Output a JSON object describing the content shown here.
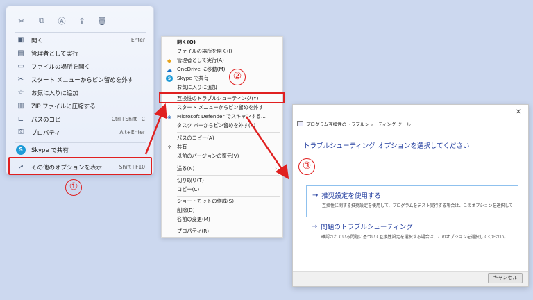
{
  "menu1": {
    "toolbar": [
      {
        "icon": "cut-icon",
        "glyph": "✂"
      },
      {
        "icon": "copy-icon",
        "glyph": "⧉"
      },
      {
        "icon": "rename-icon",
        "glyph": "Ⓐ"
      },
      {
        "icon": "share-icon",
        "glyph": "⇪"
      },
      {
        "icon": "delete-icon",
        "glyph": "🗑"
      }
    ],
    "items": [
      {
        "label": "開く",
        "shortcut": "Enter",
        "icon": "open-icon",
        "glyph": "▣"
      },
      {
        "label": "管理者として実行",
        "shortcut": "",
        "icon": "admin-run-icon",
        "glyph": "▤"
      },
      {
        "label": "ファイルの場所を開く",
        "shortcut": "",
        "icon": "folder-icon",
        "glyph": "▭"
      },
      {
        "label": "スタート メニューからピン留めを外す",
        "shortcut": "",
        "icon": "unpin-icon",
        "glyph": "✂"
      },
      {
        "label": "お気に入りに追加",
        "shortcut": "",
        "icon": "star-icon",
        "glyph": "☆"
      },
      {
        "label": "ZIP ファイルに圧縮する",
        "shortcut": "",
        "icon": "zip-icon",
        "glyph": "▥"
      },
      {
        "label": "パスのコピー",
        "shortcut": "Ctrl+Shift+C",
        "icon": "copy-path-icon",
        "glyph": "⊏"
      },
      {
        "label": "プロパティ",
        "shortcut": "Alt+Enter",
        "icon": "properties-icon",
        "glyph": "⚿"
      },
      {
        "label": "Skype で共有",
        "shortcut": "",
        "icon": "skype-icon",
        "glyph": "S"
      },
      {
        "label": "その他のオプションを表示",
        "shortcut": "Shift+F10",
        "icon": "more-options-icon",
        "glyph": "↗"
      }
    ]
  },
  "menu2": {
    "items": [
      {
        "label": "開く(O)",
        "icon": "",
        "glyph": "",
        "bold": true
      },
      {
        "label": "ファイルの場所を開く(I)",
        "icon": "",
        "glyph": ""
      },
      {
        "label": "管理者として実行(A)",
        "icon": "shield-icon",
        "glyph": "◆"
      },
      {
        "label": "OneDrive に移動(M)",
        "icon": "onedrive-icon",
        "glyph": "☁"
      },
      {
        "label": "Skype で共有",
        "icon": "skype-icon",
        "glyph": "S"
      },
      {
        "label": "お気に入りに追加",
        "icon": "",
        "glyph": ""
      },
      {
        "label": "互換性のトラブルシューティング(Y)",
        "icon": "",
        "glyph": ""
      },
      {
        "label": "スタート メニューからピン留めを外す",
        "icon": "",
        "glyph": ""
      },
      {
        "label": "Microsoft Defender でスキャンする...",
        "icon": "defender-icon",
        "glyph": "◈"
      },
      {
        "label": "タスク バーからピン留めを外す(K)",
        "icon": "",
        "glyph": ""
      },
      {
        "label": "パスのコピー(A)",
        "icon": "",
        "glyph": ""
      },
      {
        "label": "共有",
        "icon": "share-icon",
        "glyph": "⇪"
      },
      {
        "label": "以前のバージョンの復元(V)",
        "icon": "",
        "glyph": ""
      },
      {
        "label": "送る(N)",
        "icon": "",
        "glyph": "",
        "submenu": true
      },
      {
        "label": "切り取り(T)",
        "icon": "",
        "glyph": ""
      },
      {
        "label": "コピー(C)",
        "icon": "",
        "glyph": ""
      },
      {
        "label": "ショートカットの作成(S)",
        "icon": "",
        "glyph": ""
      },
      {
        "label": "削除(D)",
        "icon": "",
        "glyph": ""
      },
      {
        "label": "名前の変更(M)",
        "icon": "",
        "glyph": ""
      },
      {
        "label": "プロパティ(R)",
        "icon": "",
        "glyph": ""
      }
    ]
  },
  "dialog": {
    "title": "プログラム互換性のトラブルシューティング ツール",
    "close": "✕",
    "heading": "トラブルシューティング オプションを選択してください",
    "options": [
      {
        "title": "推奨設定を使用する",
        "desc": "互換性に関する推奨設定を使用して、プログラムをテスト実行する場合は、このオプションを選択してください"
      },
      {
        "title": "問題のトラブルシューティング",
        "desc": "確認されている問題に基づいて互換性設定を選択する場合は、このオプションを選択してください。"
      }
    ],
    "cancel": "キャンセル"
  },
  "steps": [
    "①",
    "②",
    "③"
  ],
  "colors": {
    "annotation": "#e02020",
    "link": "#1f3b9e",
    "background": "#ccd8ef"
  }
}
